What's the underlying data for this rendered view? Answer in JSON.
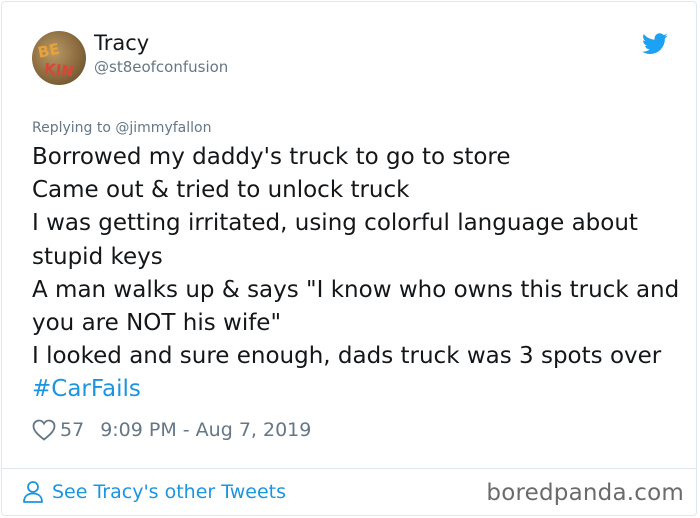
{
  "tweet": {
    "author_name": "Tracy",
    "author_handle": "@st8eofconfusion",
    "replying_prefix": "Replying to ",
    "replying_to": "@jimmyfallon",
    "text_lines": [
      "Borrowed my daddy's truck to go to store",
      "Came out & tried to unlock truck",
      "I was getting irritated, using colorful language about stupid keys",
      "A man walks up & says \"I know who owns this truck and you are NOT his wife\"",
      "I looked and sure enough, dads truck was 3 spots over "
    ],
    "hashtag": "#CarFails",
    "likes": "57",
    "timestamp": "9:09 PM - Aug 7, 2019",
    "see_more": "See Tracy's other Tweets",
    "avatar_text": "BE KIN"
  },
  "icons": {
    "bird": "twitter-bird-icon",
    "heart": "heart-icon",
    "person": "person-icon"
  },
  "watermark": "boredpanda.com",
  "colors": {
    "text": "#14171a",
    "muted": "#657786",
    "link": "#1b95e0",
    "bird": "#1da1f2",
    "border": "#e1e8ed"
  }
}
